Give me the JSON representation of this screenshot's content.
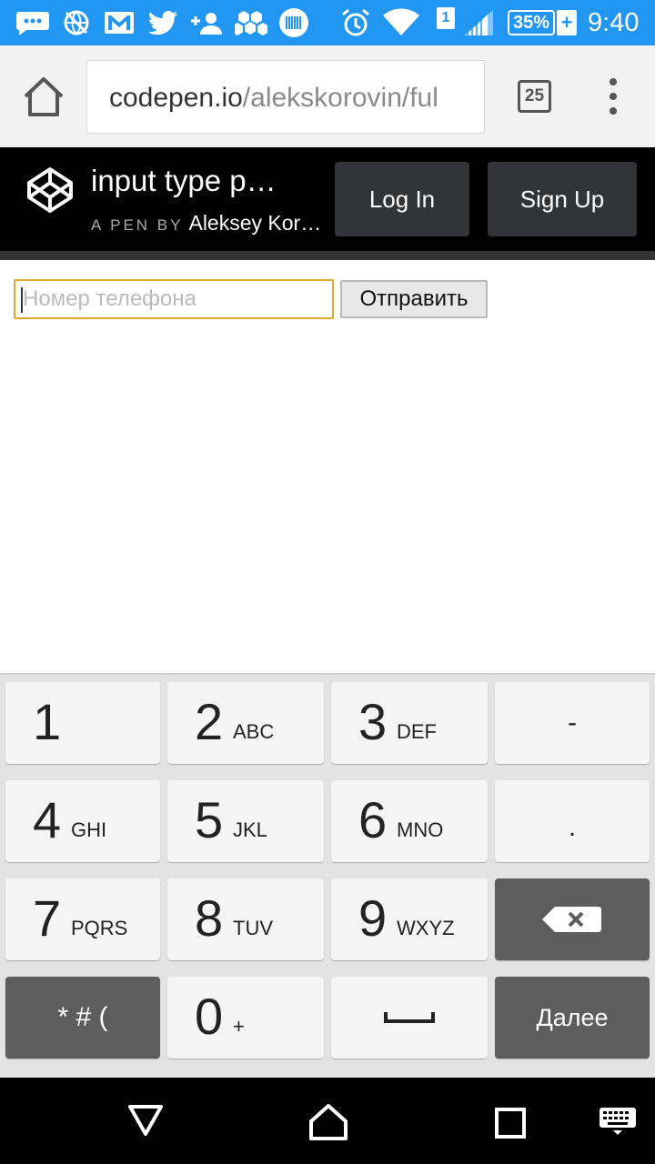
{
  "status_bar": {
    "battery_percent": "35%",
    "battery_plus": "+",
    "sim_number": "1",
    "time": "9:40"
  },
  "browser": {
    "url_host": "codepen.io",
    "url_path": "/alekskorovin/ful",
    "tab_count": "25"
  },
  "codepen": {
    "pen_title": "input type p…",
    "pen_by_label": "A PEN BY",
    "author": "Aleksey Kor…",
    "login_label": "Log In",
    "signup_label": "Sign Up"
  },
  "form": {
    "phone_placeholder": "Номер телефона",
    "submit_label": "Отправить"
  },
  "keyboard": {
    "keys": {
      "k1": {
        "num": "1",
        "letters": ""
      },
      "k2": {
        "num": "2",
        "letters": "ABC"
      },
      "k3": {
        "num": "3",
        "letters": "DEF"
      },
      "k4": {
        "num": "4",
        "letters": "GHI"
      },
      "k5": {
        "num": "5",
        "letters": "JKL"
      },
      "k6": {
        "num": "6",
        "letters": "MNO"
      },
      "k7": {
        "num": "7",
        "letters": "PQRS"
      },
      "k8": {
        "num": "8",
        "letters": "TUV"
      },
      "k9": {
        "num": "9",
        "letters": "WXYZ"
      },
      "k0": {
        "num": "0",
        "letters": "+"
      }
    },
    "dash": "-",
    "dot": ".",
    "symbols": "* # (",
    "next_label": "Далее"
  }
}
